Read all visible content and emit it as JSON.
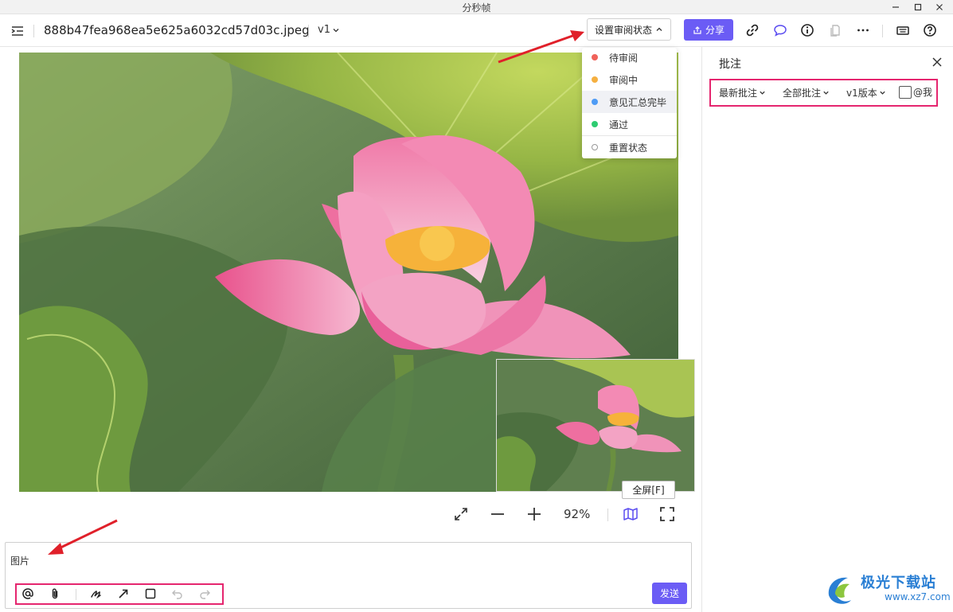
{
  "window": {
    "title": "分秒帧"
  },
  "toolbar": {
    "filename": "888b47fea968ea5e625a6032cd57d03c.jpeg",
    "version": "v1",
    "review_status_label": "设置审阅状态",
    "share_label": "分享"
  },
  "status_menu": {
    "items": [
      {
        "label": "待审阅",
        "color": "#f0625a"
      },
      {
        "label": "审阅中",
        "color": "#f5b041"
      },
      {
        "label": "意见汇总完毕",
        "color": "#4f9cf5"
      },
      {
        "label": "通过",
        "color": "#2ecc71"
      }
    ],
    "reset_label": "重置状态"
  },
  "viewer": {
    "zoom": "92%",
    "fullscreen_tooltip": "全屏[F]"
  },
  "comment": {
    "text": "图片",
    "send_label": "发送"
  },
  "panel": {
    "title": "批注",
    "filters": {
      "sort": "最新批注",
      "scope": "全部批注",
      "version": "v1版本",
      "at_me": "@我"
    }
  },
  "watermark": {
    "name": "极光下载站",
    "url": "www.xz7.com"
  },
  "colors": {
    "accent": "#6b5cf5",
    "highlight": "#e5266f",
    "arrow": "#e0202a"
  }
}
